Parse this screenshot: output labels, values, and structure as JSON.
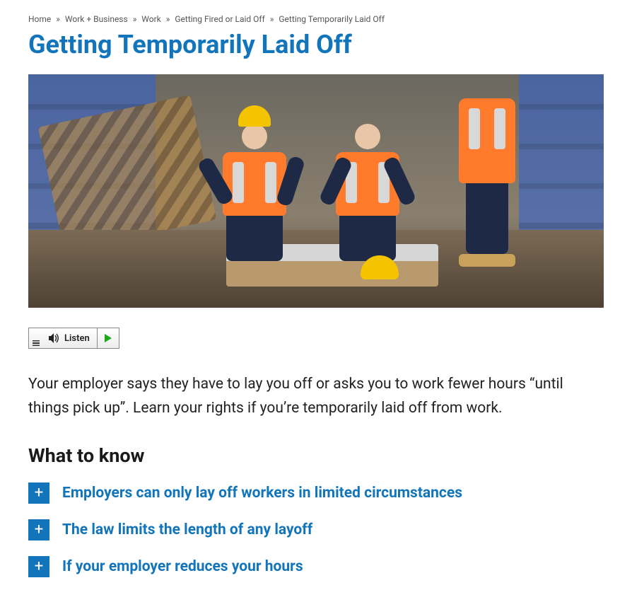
{
  "breadcrumb": {
    "items": [
      {
        "label": "Home"
      },
      {
        "label": "Work + Business"
      },
      {
        "label": "Work"
      },
      {
        "label": "Getting Fired or Laid Off"
      }
    ],
    "separator": "»",
    "current": "Getting Temporarily Laid Off"
  },
  "page": {
    "title": "Getting Temporarily Laid Off",
    "intro": "Your employer says they have to lay you off or asks you to work fewer hours “until things pick up”. Learn your rights if you’re temporarily laid off from work."
  },
  "hero": {
    "alt": "Two construction workers in orange safety vests sitting dejectedly on a pallet in a warehouse, one holding his head; a third worker stands in the background."
  },
  "listen": {
    "label": "Listen"
  },
  "section": {
    "heading": "What to know"
  },
  "accordion": [
    {
      "title": "Employers can only lay off workers in limited circumstances"
    },
    {
      "title": "The law limits the length of any layoff"
    },
    {
      "title": "If your employer reduces your hours"
    }
  ]
}
